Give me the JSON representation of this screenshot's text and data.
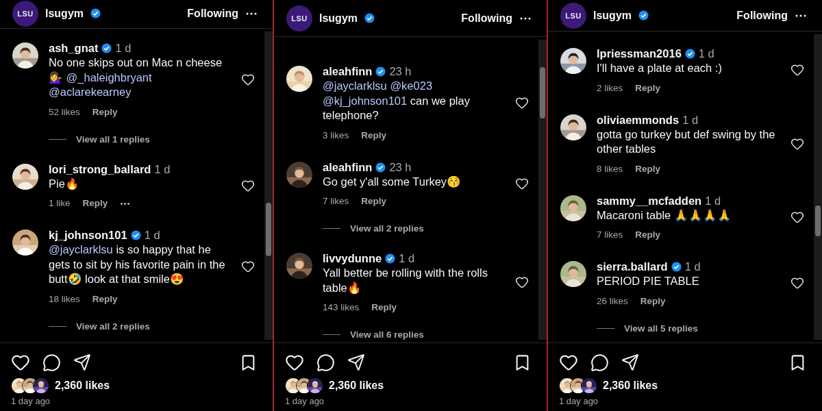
{
  "panels": [
    {
      "header": {
        "logo_text": "LSU",
        "account": "lsugym",
        "verified": true,
        "follow_label": "Following"
      },
      "comments": [
        {
          "user": "ash_gnat",
          "verified": true,
          "time": "1 d",
          "text": [
            {
              "text": "No one skips out on Mac n cheese 💁‍♀️",
              "mention": false
            },
            {
              "text": "@_haleighbryant",
              "mention": true
            },
            {
              "text": "@aclarekearney",
              "mention": true
            }
          ],
          "likes": "52 likes",
          "reply": "Reply",
          "view_replies": "View all 1 replies"
        },
        {
          "user": "lori_strong_ballard",
          "verified": false,
          "time": "1 d",
          "text": [
            {
              "text": "Pie🔥",
              "mention": false
            }
          ],
          "likes": "1 like",
          "reply": "Reply",
          "more_menu": true
        },
        {
          "user": "kj_johnson101",
          "verified": true,
          "time": "1 d",
          "text": [
            {
              "text": "@jayclarklsu",
              "mention": true
            },
            {
              "text": "is so happy that he gets to sit by his favorite pain in the butt🤣 look at that smile😍",
              "mention": false
            }
          ],
          "likes": "18 likes",
          "reply": "Reply",
          "view_replies": "View all 2 replies"
        }
      ],
      "footer": {
        "likes": "2,360 likes",
        "date": "1 day ago"
      }
    },
    {
      "header": {
        "logo_text": "LSU",
        "account": "lsugym",
        "verified": true,
        "follow_label": "Following"
      },
      "comments": [
        {
          "user": "aleahfinn",
          "verified": true,
          "time": "23 h",
          "text": [
            {
              "text": "@jayclarklsu",
              "mention": true
            },
            {
              "text": "@ke023",
              "mention": true
            },
            {
              "text": "@kj_johnson101",
              "mention": true
            },
            {
              "text": "can we play telephone?",
              "mention": false
            }
          ],
          "likes": "3 likes",
          "reply": "Reply"
        },
        {
          "user": "aleahfinn",
          "verified": true,
          "time": "23 h",
          "text": [
            {
              "text": "Go get y'all some Turkey😚",
              "mention": false
            }
          ],
          "likes": "7 likes",
          "reply": "Reply",
          "view_replies": "View all 2 replies"
        },
        {
          "user": "livvydunne",
          "verified": true,
          "time": "1 d",
          "text": [
            {
              "text": "Yall better be rolling with the rolls table🔥",
              "mention": false
            }
          ],
          "likes": "143 likes",
          "reply": "Reply",
          "view_replies": "View all 6 replies"
        }
      ],
      "footer": {
        "likes": "2,360 likes",
        "date": "1 day ago"
      }
    },
    {
      "header": {
        "logo_text": "LSU",
        "account": "lsugym",
        "verified": true,
        "follow_label": "Following"
      },
      "comments": [
        {
          "user": "lpriessman2016",
          "verified": true,
          "time": "1 d",
          "text": [
            {
              "text": "I'll have a plate at each :)",
              "mention": false
            }
          ],
          "likes": "2 likes",
          "reply": "Reply"
        },
        {
          "user": "oliviaemmonds",
          "verified": false,
          "time": "1 d",
          "text": [
            {
              "text": "gotta go turkey but def swing by the other tables",
              "mention": false
            }
          ],
          "likes": "8 likes",
          "reply": "Reply"
        },
        {
          "user": "sammy__mcfadden",
          "verified": false,
          "time": "1 d",
          "text": [
            {
              "text": "Macaroni table 🙏🙏🙏🙏",
              "mention": false
            }
          ],
          "likes": "7 likes",
          "reply": "Reply"
        },
        {
          "user": "sierra.ballard",
          "verified": true,
          "time": "1 d",
          "text": [
            {
              "text": "PERIOD PIE TABLE",
              "mention": false
            }
          ],
          "likes": "26 likes",
          "reply": "Reply",
          "view_replies": "View all 5 replies"
        }
      ],
      "footer": {
        "likes": "2,360 likes",
        "date": "1 day ago"
      }
    }
  ]
}
